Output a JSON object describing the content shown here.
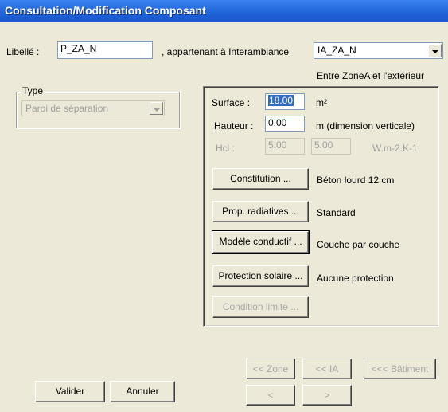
{
  "window": {
    "title": "Consultation/Modification Composant"
  },
  "header": {
    "libelle_label": "Libellé :",
    "libelle_value": "P_ZA_N",
    "appartenant_label": ", appartenant à Interambiance",
    "interambiance_value": "IA_ZA_N",
    "between_text": "Entre ZoneA et l'extérieur"
  },
  "type_group": {
    "title": "Type",
    "value": "Paroi de séparation"
  },
  "properties": {
    "surface_label": "Surface :",
    "surface_value": "18.00",
    "surface_unit": "m²",
    "hauteur_label": "Hauteur :",
    "hauteur_value": "0.00",
    "hauteur_unit": "m  (dimension verticale)",
    "hci_label": "Hci :",
    "hci_value1": "5.00",
    "hci_value2": "5.00",
    "hci_unit": "W.m-2.K-1"
  },
  "buttons": {
    "constitution": "Constitution ...",
    "prop_radiatives": "Prop. radiatives ...",
    "modele_conductif": "Modèle conductif ...",
    "protection_solaire": "Protection solaire ...",
    "condition_limite": "Condition limite ...",
    "nav_zone": "<< Zone",
    "nav_ia": "<< IA",
    "nav_batiment": "<<< Bâtiment",
    "nav_prev": "<",
    "nav_next": ">",
    "valider": "Valider",
    "annuler": "Annuler"
  },
  "values": {
    "constitution": "Béton lourd 12 cm",
    "prop_radiatives": "Standard",
    "modele_conductif": "Couche par couche",
    "protection_solaire": "Aucune protection"
  }
}
